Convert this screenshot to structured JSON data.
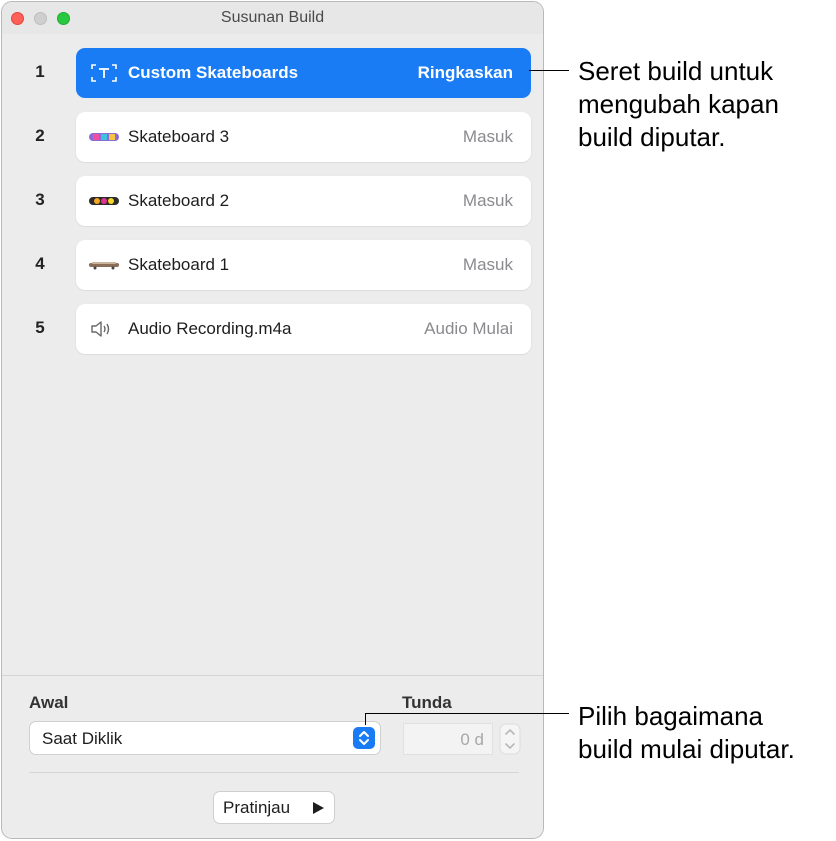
{
  "window": {
    "title": "Susunan Build"
  },
  "builds": [
    {
      "number": "1",
      "icon": "text-box-icon",
      "label": "Custom Skateboards",
      "effect": "Ringkaskan",
      "selected": true
    },
    {
      "number": "2",
      "icon": "skateboard-thumbnail-icon",
      "label": "Skateboard 3",
      "effect": "Masuk",
      "selected": false
    },
    {
      "number": "3",
      "icon": "skateboard-thumbnail-icon",
      "label": "Skateboard 2",
      "effect": "Masuk",
      "selected": false
    },
    {
      "number": "4",
      "icon": "skateboard-thumbnail-icon",
      "label": "Skateboard 1",
      "effect": "Masuk",
      "selected": false
    },
    {
      "number": "5",
      "icon": "speaker-icon",
      "label": "Audio Recording.m4a",
      "effect": "Audio Mulai",
      "selected": false
    }
  ],
  "controls": {
    "start_label": "Awal",
    "start_value": "Saat Diklik",
    "delay_label": "Tunda",
    "delay_value": "0 d",
    "preview_label": "Pratinjau"
  },
  "callouts": {
    "drag": [
      "Seret build untuk",
      "mengubah kapan",
      "build diputar."
    ],
    "start": [
      "Pilih bagaimana",
      "build mulai diputar."
    ]
  },
  "colors": {
    "accent": "#1a7cf5",
    "close": "#fe5f57",
    "zoom": "#2ac840"
  }
}
